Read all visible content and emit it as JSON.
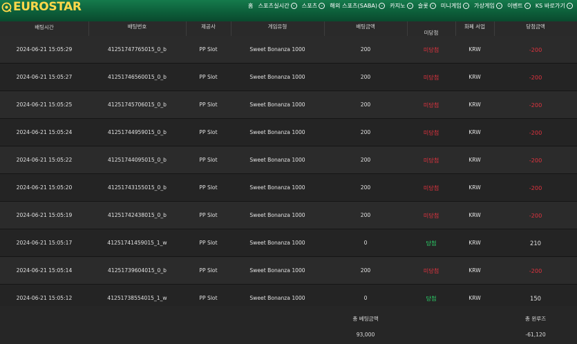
{
  "brand": {
    "logo_text": "EUROSTAR",
    "logo_color": "#ffd84a"
  },
  "nav": {
    "items": [
      {
        "label": "홈",
        "has_chevron": false
      },
      {
        "label": "스포츠실시간",
        "has_chevron": true
      },
      {
        "label": "스포츠",
        "has_chevron": true
      },
      {
        "label": "해외 스포츠(SABA)",
        "has_chevron": true
      },
      {
        "label": "카지노",
        "has_chevron": true
      },
      {
        "label": "슬롯",
        "has_chevron": true
      },
      {
        "label": "미니게임",
        "has_chevron": true
      },
      {
        "label": "가상게임",
        "has_chevron": true
      },
      {
        "label": "이벤트",
        "has_chevron": true
      },
      {
        "label": "KS 바로가기",
        "has_chevron": true
      }
    ]
  },
  "table": {
    "headers": [
      "배팅시간",
      "배팅번호",
      "제공사",
      "게임유형",
      "배팅금액",
      "미당첨",
      "화폐 서업",
      "당첨금액"
    ],
    "rows": [
      {
        "time": "2024-06-21 15:05:29",
        "bet_no": "41251747765015_0_b",
        "provider": "PP Slot",
        "game": "Sweet Bonanza 1000",
        "amount": "200",
        "result": "미당첨",
        "result_type": "lose",
        "currency": "KRW",
        "payout": "-200"
      },
      {
        "time": "2024-06-21 15:05:27",
        "bet_no": "41251746560015_0_b",
        "provider": "PP Slot",
        "game": "Sweet Bonanza 1000",
        "amount": "200",
        "result": "미당첨",
        "result_type": "lose",
        "currency": "KRW",
        "payout": "-200"
      },
      {
        "time": "2024-06-21 15:05:25",
        "bet_no": "41251745706015_0_b",
        "provider": "PP Slot",
        "game": "Sweet Bonanza 1000",
        "amount": "200",
        "result": "미당첨",
        "result_type": "lose",
        "currency": "KRW",
        "payout": "-200"
      },
      {
        "time": "2024-06-21 15:05:24",
        "bet_no": "41251744959015_0_b",
        "provider": "PP Slot",
        "game": "Sweet Bonanza 1000",
        "amount": "200",
        "result": "미당첨",
        "result_type": "lose",
        "currency": "KRW",
        "payout": "-200"
      },
      {
        "time": "2024-06-21 15:05:22",
        "bet_no": "41251744095015_0_b",
        "provider": "PP Slot",
        "game": "Sweet Bonanza 1000",
        "amount": "200",
        "result": "미당첨",
        "result_type": "lose",
        "currency": "KRW",
        "payout": "-200"
      },
      {
        "time": "2024-06-21 15:05:20",
        "bet_no": "41251743155015_0_b",
        "provider": "PP Slot",
        "game": "Sweet Bonanza 1000",
        "amount": "200",
        "result": "미당첨",
        "result_type": "lose",
        "currency": "KRW",
        "payout": "-200"
      },
      {
        "time": "2024-06-21 15:05:19",
        "bet_no": "41251742438015_0_b",
        "provider": "PP Slot",
        "game": "Sweet Bonanza 1000",
        "amount": "200",
        "result": "미당첨",
        "result_type": "lose",
        "currency": "KRW",
        "payout": "-200"
      },
      {
        "time": "2024-06-21 15:05:17",
        "bet_no": "41251741459015_1_w",
        "provider": "PP Slot",
        "game": "Sweet Bonanza 1000",
        "amount": "0",
        "result": "당첨",
        "result_type": "win",
        "currency": "KRW",
        "payout": "210"
      },
      {
        "time": "2024-06-21 15:05:14",
        "bet_no": "41251739604015_0_b",
        "provider": "PP Slot",
        "game": "Sweet Bonanza 1000",
        "amount": "200",
        "result": "미당첨",
        "result_type": "lose",
        "currency": "KRW",
        "payout": "-200"
      },
      {
        "time": "2024-06-21 15:05:12",
        "bet_no": "41251738554015_1_w",
        "provider": "PP Slot",
        "game": "Sweet Bonanza 1000",
        "amount": "0",
        "result": "당첨",
        "result_type": "win",
        "currency": "KRW",
        "payout": "150"
      }
    ]
  },
  "summary": {
    "total_bet_label": "총 베팅금액",
    "total_bet_value": "93,000",
    "total_win_label": "총 윈루즈",
    "total_win_value": "-61,120"
  },
  "colors": {
    "header_green": "#0d5f3a",
    "lose_red": "#e1333f",
    "win_green": "#2bd46a"
  }
}
